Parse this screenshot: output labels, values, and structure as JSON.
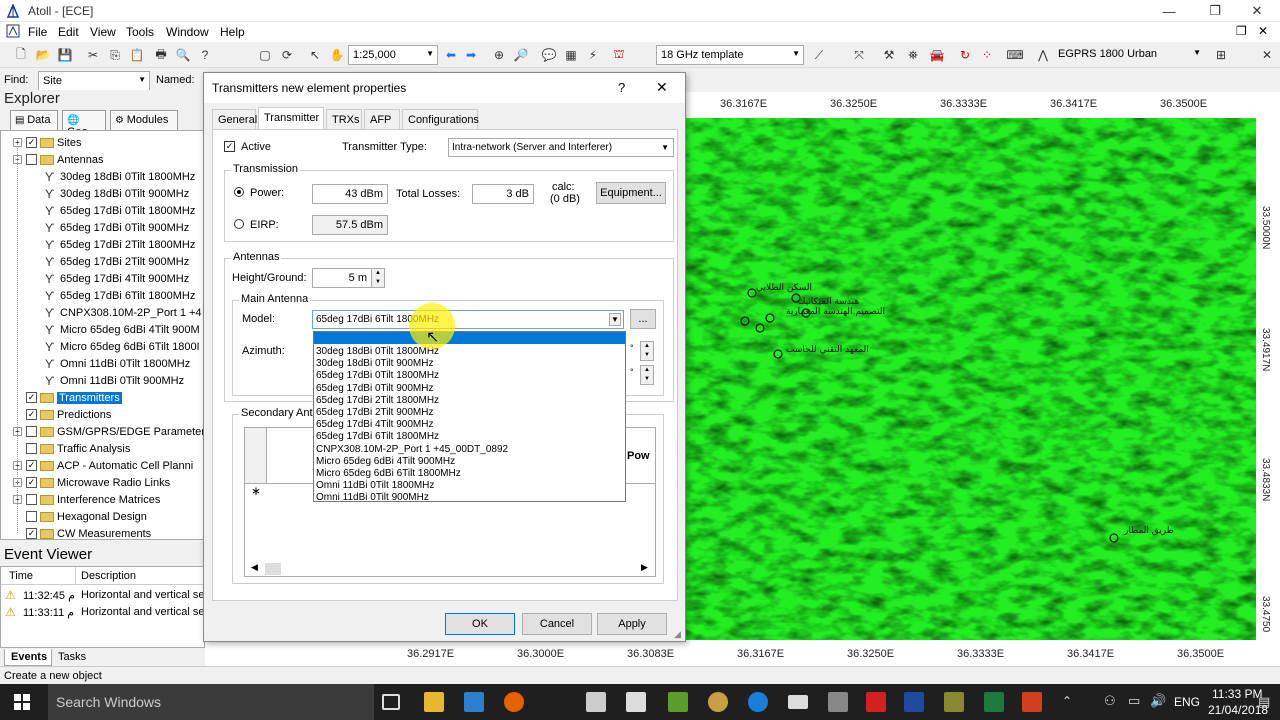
{
  "window": {
    "title": "Atoll - [ECE]",
    "controls": [
      "—",
      "❐",
      "✕"
    ]
  },
  "menu": [
    "File",
    "Edit",
    "View",
    "Tools",
    "Window",
    "Help"
  ],
  "toolbar": {
    "scale": "1:25,000",
    "template": "18 GHz template",
    "layer": "EGPRS 1800 Urban"
  },
  "findbar": {
    "label": "Find:",
    "value": "Site",
    "named_label": "Named:"
  },
  "explorer": {
    "title": "Explorer",
    "tabs": [
      "Data",
      "Geo",
      "Modules"
    ],
    "tree": [
      {
        "label": "Sites",
        "level": 1,
        "type": "folder",
        "checked": true,
        "expand": "+"
      },
      {
        "label": "Antennas",
        "level": 1,
        "type": "folder",
        "checked": false,
        "expand": "−"
      },
      {
        "label": "30deg 18dBi 0Tilt 1800MHz",
        "level": 2,
        "type": "antenna"
      },
      {
        "label": "30deg 18dBi 0Tilt 900MHz",
        "level": 2,
        "type": "antenna"
      },
      {
        "label": "65deg 17dBi 0Tilt 1800MHz",
        "level": 2,
        "type": "antenna"
      },
      {
        "label": "65deg 17dBi 0Tilt 900MHz",
        "level": 2,
        "type": "antenna"
      },
      {
        "label": "65deg 17dBi 2Tilt 1800MHz",
        "level": 2,
        "type": "antenna"
      },
      {
        "label": "65deg 17dBi 2Tilt 900MHz",
        "level": 2,
        "type": "antenna"
      },
      {
        "label": "65deg 17dBi 4Tilt 900MHz",
        "level": 2,
        "type": "antenna"
      },
      {
        "label": "65deg 17dBi 6Tilt 1800MHz",
        "level": 2,
        "type": "antenna"
      },
      {
        "label": "CNPX308.10M-2P_Port 1 +4",
        "level": 2,
        "type": "antenna"
      },
      {
        "label": "Micro 65deg 6dBi 4Tilt 900M",
        "level": 2,
        "type": "antenna"
      },
      {
        "label": "Micro 65deg 6dBi 6Tilt 1800I",
        "level": 2,
        "type": "antenna"
      },
      {
        "label": "Omni 11dBi 0Tilt 1800MHz",
        "level": 2,
        "type": "antenna"
      },
      {
        "label": "Omni 11dBi 0Tilt 900MHz",
        "level": 2,
        "type": "antenna"
      },
      {
        "label": "Transmitters",
        "level": 1,
        "type": "folder",
        "checked": true,
        "selected": true
      },
      {
        "label": "Predictions",
        "level": 1,
        "type": "folder",
        "checked": true
      },
      {
        "label": "GSM/GPRS/EDGE Parameters",
        "level": 1,
        "type": "folder",
        "expand": "+"
      },
      {
        "label": "Traffic Analysis",
        "level": 1,
        "type": "folder"
      },
      {
        "label": "ACP - Automatic Cell Planni",
        "level": 1,
        "type": "folder",
        "checked": true,
        "expand": "+"
      },
      {
        "label": "Microwave Radio Links",
        "level": 1,
        "type": "folder",
        "checked": true,
        "expand": "+"
      },
      {
        "label": "Interference Matrices",
        "level": 1,
        "type": "folder",
        "expand": "+"
      },
      {
        "label": "Hexagonal Design",
        "level": 1,
        "type": "folder"
      },
      {
        "label": "CW Measurements",
        "level": 1,
        "type": "folder",
        "checked": true
      }
    ]
  },
  "events": {
    "title": "Event Viewer",
    "columns": [
      "Time",
      "Description"
    ],
    "rows": [
      {
        "time": "11:32:45 م",
        "desc": "Horizontal and vertical se"
      },
      {
        "time": "11:33:11 م",
        "desc": "Horizontal and vertical se"
      }
    ],
    "tabs": [
      "Events",
      "Tasks"
    ]
  },
  "status": {
    "text": "Create a new object"
  },
  "map": {
    "top_ticks": [
      "36.3167E",
      "36.3250E",
      "36.3333E",
      "36.3417E",
      "36.3500E"
    ],
    "bottom_ticks": [
      "36.2917E",
      "36.3000E",
      "36.3083E",
      "36.3167E",
      "36.3250E",
      "36.3333E",
      "36.3417E",
      "36.3500E"
    ],
    "right_ticks": [
      "33.5000N",
      "33.4917N",
      "33.4833N",
      "33.4750"
    ],
    "labels": [
      "السكن الطلابي",
      "المعهد التقني للحاسب",
      "طريق المطار",
      "التصميم الهندسة المعمارية",
      "هندسة الميكانيك"
    ],
    "color": "#22ee22"
  },
  "dialog": {
    "title": "Transmitters new element properties",
    "help": "?",
    "close": "✕",
    "tabs": [
      "General",
      "Transmitter",
      "TRXs",
      "AFP",
      "Configurations"
    ],
    "active_label": "Active",
    "tx_type_label": "Transmitter Type:",
    "tx_type_value": "Intra-network (Server and Interferer)",
    "transmission_group": "Transmission",
    "power_label": "Power:",
    "power_value": "43 dBm",
    "losses_label": "Total Losses:",
    "losses_value": "3 dB",
    "calc_label": "calc:",
    "calc_value": "(0 dB)",
    "equipment_button": "Equipment...",
    "eirp_label": "EIRP:",
    "eirp_value": "57.5 dBm",
    "antennas_group": "Antennas",
    "height_label": "Height/Ground:",
    "height_value": "5 m",
    "main_antenna_group": "Main Antenna",
    "model_label": "Model:",
    "model_value": "65deg 17dBi 6Tilt 1800MHz",
    "azimuth_label": "Azimuth:",
    "secondary_group": "Secondary Ante",
    "grid_partial_header": "Pow",
    "grid_new_row": "∗",
    "ok": "OK",
    "cancel": "Cancel",
    "apply": "Apply",
    "dropdown_items": [
      "30deg 18dBi 0Tilt 1800MHz",
      "30deg 18dBi 0Tilt 900MHz",
      "65deg 17dBi 0Tilt 1800MHz",
      "65deg 17dBi 0Tilt 900MHz",
      "65deg 17dBi 2Tilt 1800MHz",
      "65deg 17dBi 2Tilt 900MHz",
      "65deg 17dBi 4Tilt 900MHz",
      "65deg 17dBi 6Tilt 1800MHz",
      "CNPX308.10M-2P_Port 1 +45_00DT_0892",
      "Micro 65deg 6dBi 4Tilt 900MHz",
      "Micro 65deg 6dBi 6Tilt 1800MHz",
      "Omni 11dBi 0Tilt 1800MHz",
      "Omni 11dBi 0Tilt 900MHz"
    ]
  },
  "taskbar": {
    "search_placeholder": "Search Windows",
    "lang": "ENG",
    "time": "11:33 PM",
    "date": "21/04/2018"
  }
}
